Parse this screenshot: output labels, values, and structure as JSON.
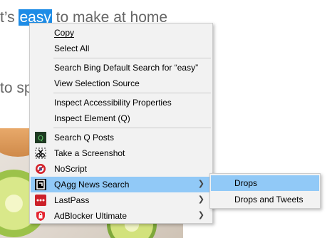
{
  "page": {
    "line1_before": "t’s ",
    "line1_selected": "easy",
    "line1_after": " to make at home",
    "line2": "to spa"
  },
  "menu": {
    "copy": "Copy",
    "select_all": "Select All",
    "search": "Search Bing Default Search for “easy”",
    "view_source": "View Selection Source",
    "inspect_accessibility": "Inspect Accessibility Properties",
    "inspect_element": "Inspect Element (Q)",
    "search_q_posts": "Search Q Posts",
    "screenshot": "Take a Screenshot",
    "noscript": "NoScript",
    "qagg": "QAgg News Search",
    "lastpass": "LastPass",
    "adblocker": "AdBlocker Ultimate"
  },
  "submenu": {
    "drops": "Drops",
    "drops_and_tweets": "Drops and Tweets"
  },
  "icons": {
    "search_q_posts": "q-posts-icon",
    "screenshot": "scissors-icon",
    "noscript": "noscript-icon",
    "qagg": "qagg-icon",
    "lastpass": "lastpass-icon",
    "adblocker": "adblocker-icon",
    "submenu_arrow": "chevron-right-icon"
  },
  "colors": {
    "selection": "#1e8ce6",
    "hover": "#91c9f7",
    "menu_bg": "#f2f2f2"
  }
}
